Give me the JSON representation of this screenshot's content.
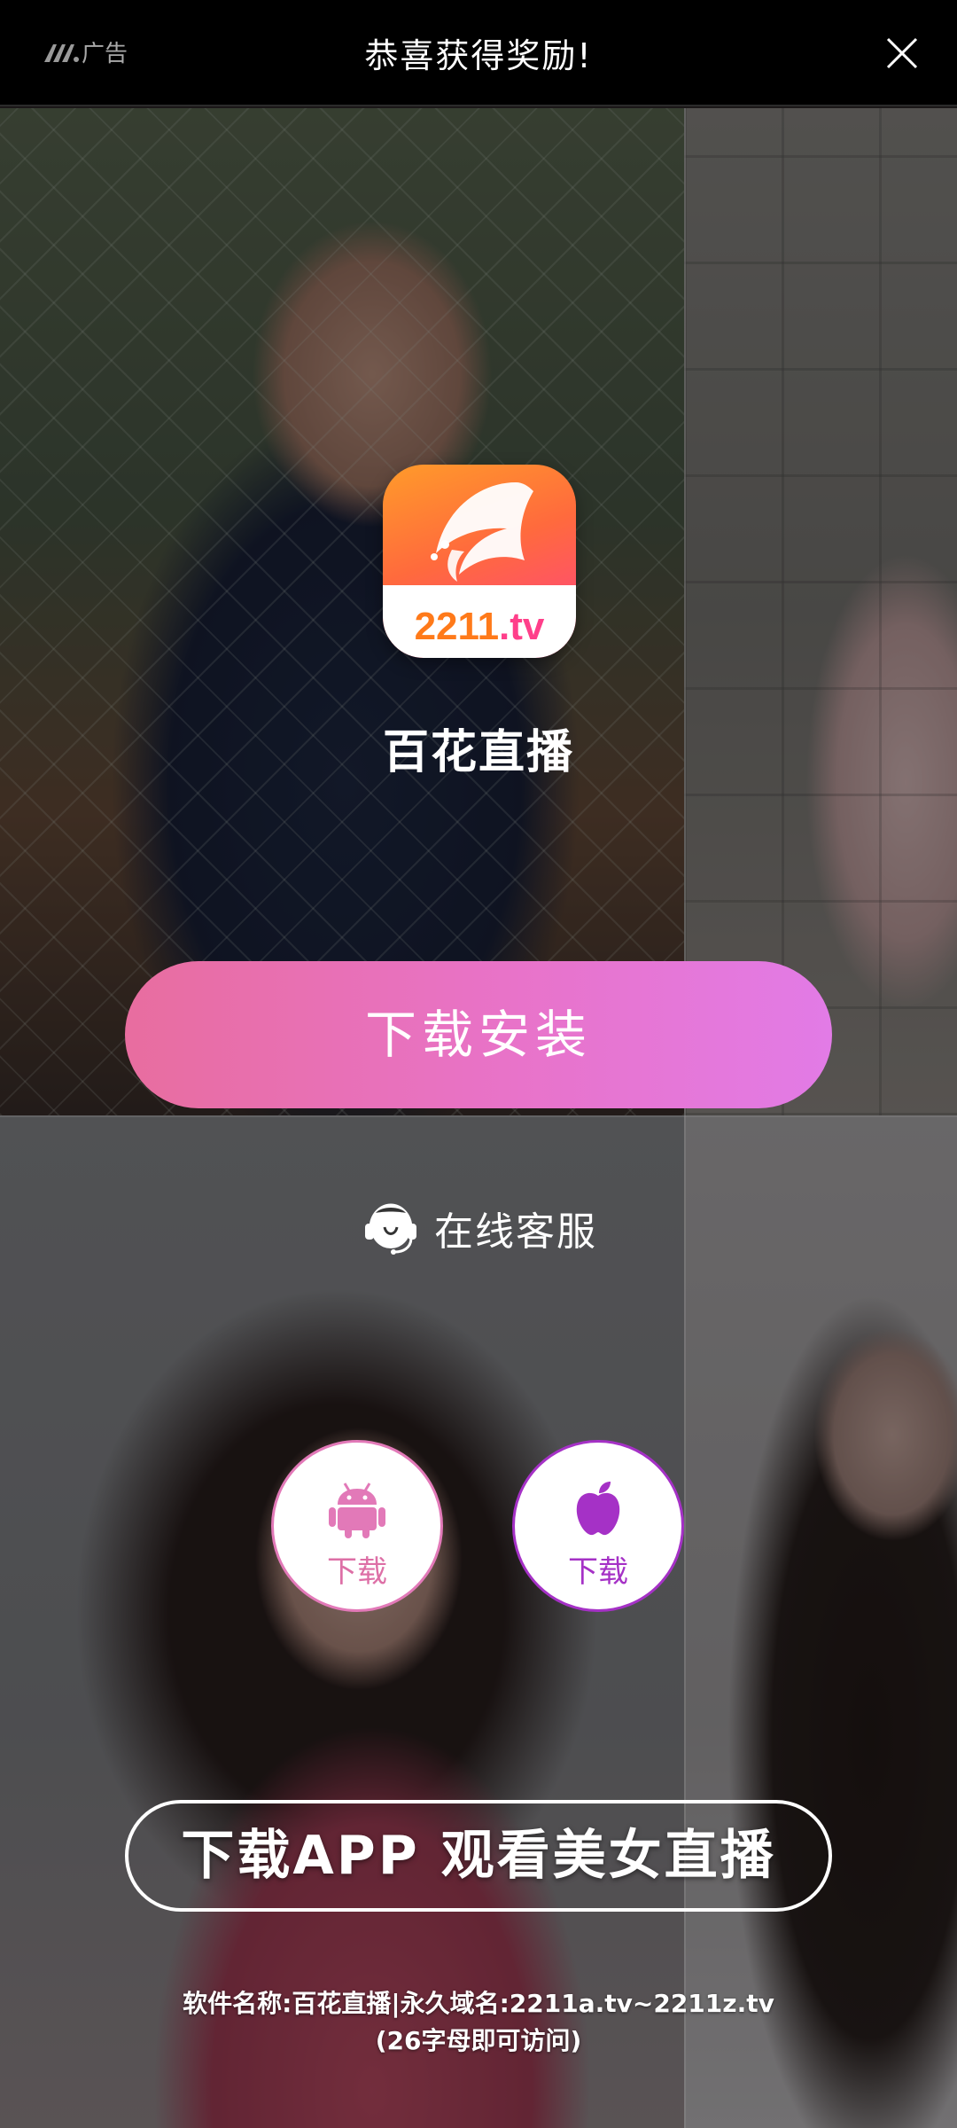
{
  "top_bar": {
    "ad_label": "广告",
    "title": "恭喜获得奖励!"
  },
  "app": {
    "icon_text_number": "2211",
    "icon_text_tld": ".tv",
    "name": "百花直播"
  },
  "buttons": {
    "install": "下载安装",
    "support": "在线客服",
    "android_download": "下载",
    "ios_download": "下载",
    "banner": "下载APP 观看美女直播"
  },
  "footer": {
    "line1": "软件名称:百花直播|永久域名:2211a.tv~2211z.tv",
    "line2": "(26字母即可访问)"
  },
  "icons": [
    "ad-logo-icon",
    "close-icon",
    "app-logo-icon",
    "headset-icon",
    "android-icon",
    "apple-icon"
  ],
  "colors": {
    "install_gradient_start": "#e86d9f",
    "install_gradient_end": "#e27be6",
    "android_accent": "#e279b8",
    "ios_accent": "#a531c6",
    "top_bar_bg": "#000000"
  }
}
